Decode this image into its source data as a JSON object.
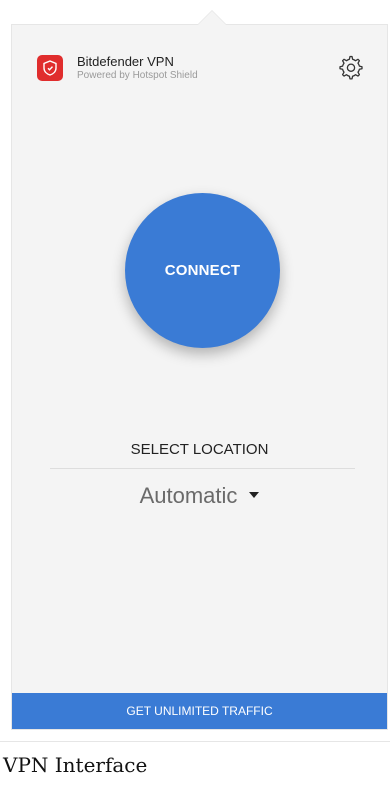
{
  "app": {
    "name": "Bitdefender VPN",
    "subtitle": "Powered by Hotspot Shield",
    "logo_icon": "shield-logo-icon",
    "settings_icon": "gear-icon"
  },
  "main": {
    "connect_label": "CONNECT",
    "select_location_label": "SELECT LOCATION",
    "location_value": "Automatic",
    "dropdown_icon": "caret-down-icon"
  },
  "footer": {
    "upgrade_label": "GET UNLIMITED TRAFFIC"
  },
  "caption": "VPN Interface",
  "colors": {
    "accent_blue": "#3a7bd5",
    "logo_red": "#e02d2d",
    "panel_bg": "#f4f4f4"
  }
}
